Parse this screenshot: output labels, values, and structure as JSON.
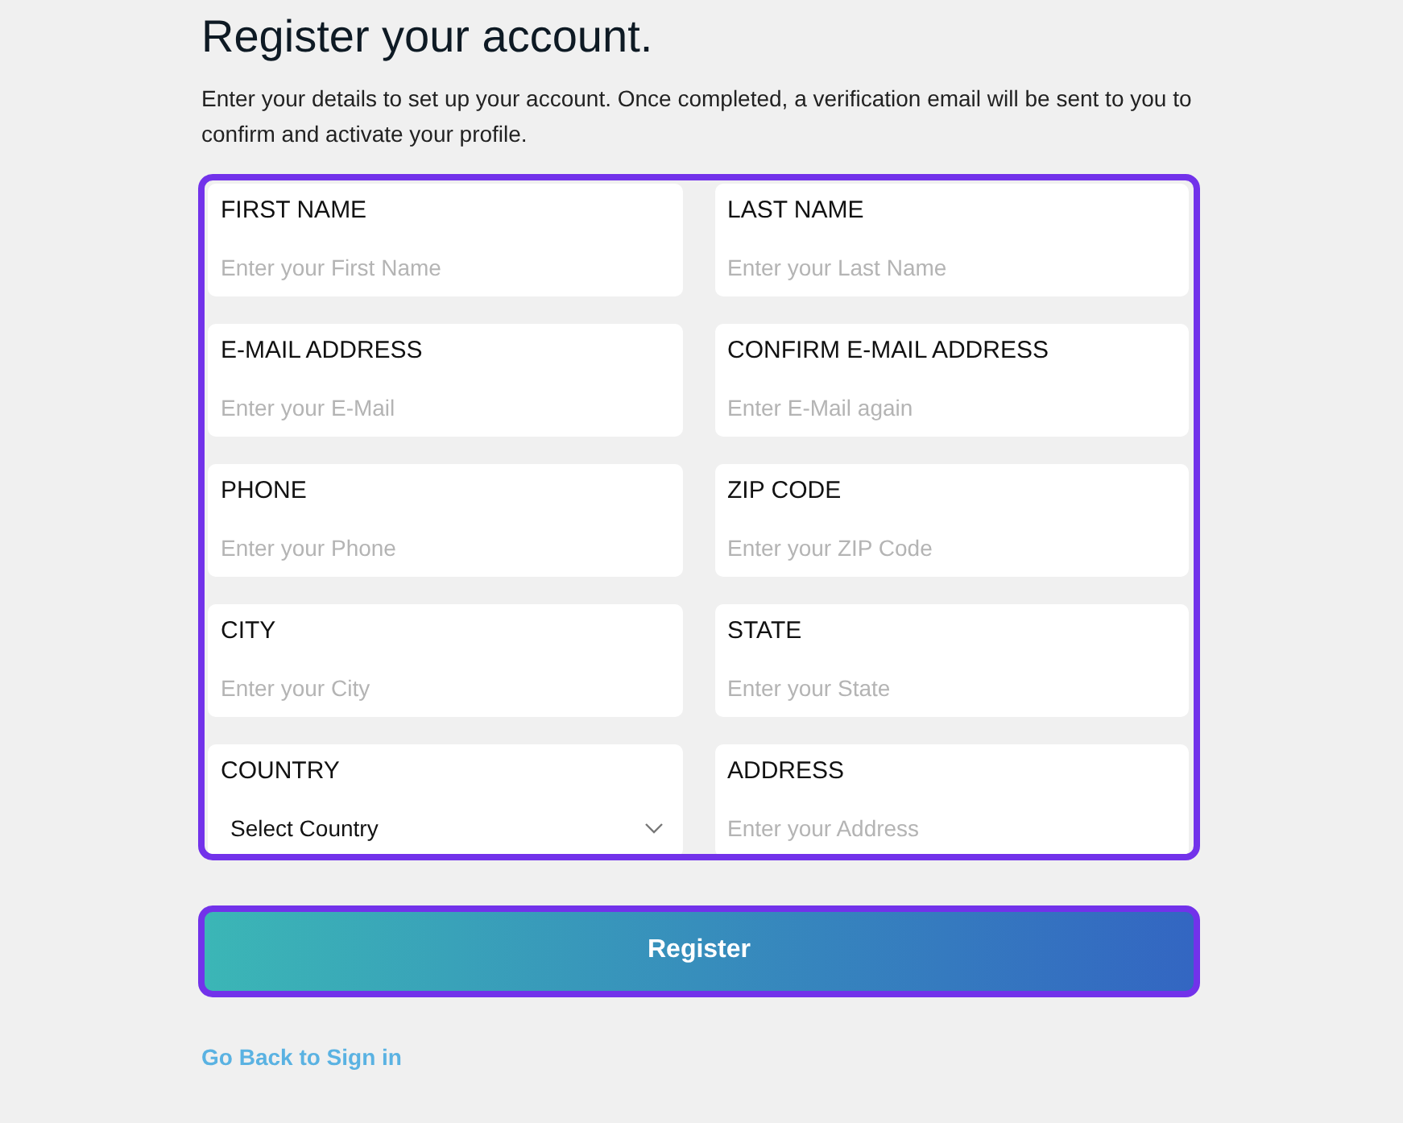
{
  "title": "Register your account.",
  "description": "Enter your details to set up your account. Once completed, a verification email will be sent to you to confirm and activate your profile.",
  "fields": [
    {
      "label": "FIRST NAME",
      "kind": "text",
      "placeholder": "Enter your First Name"
    },
    {
      "label": "LAST NAME",
      "kind": "text",
      "placeholder": "Enter your Last Name"
    },
    {
      "label": "E-MAIL ADDRESS",
      "kind": "text",
      "placeholder": "Enter your E-Mail"
    },
    {
      "label": "CONFIRM E-MAIL ADDRESS",
      "kind": "text",
      "placeholder": "Enter E-Mail again"
    },
    {
      "label": "PHONE",
      "kind": "text",
      "placeholder": "Enter your Phone"
    },
    {
      "label": "ZIP CODE",
      "kind": "text",
      "placeholder": "Enter your ZIP Code"
    },
    {
      "label": "CITY",
      "kind": "text",
      "placeholder": "Enter your City"
    },
    {
      "label": "STATE",
      "kind": "text",
      "placeholder": "Enter your State"
    },
    {
      "label": "COUNTRY",
      "kind": "select",
      "value": "Select Country"
    },
    {
      "label": "ADDRESS",
      "kind": "text",
      "placeholder": "Enter your Address"
    }
  ],
  "register_button": "Register",
  "back_link": "Go Back to Sign in"
}
